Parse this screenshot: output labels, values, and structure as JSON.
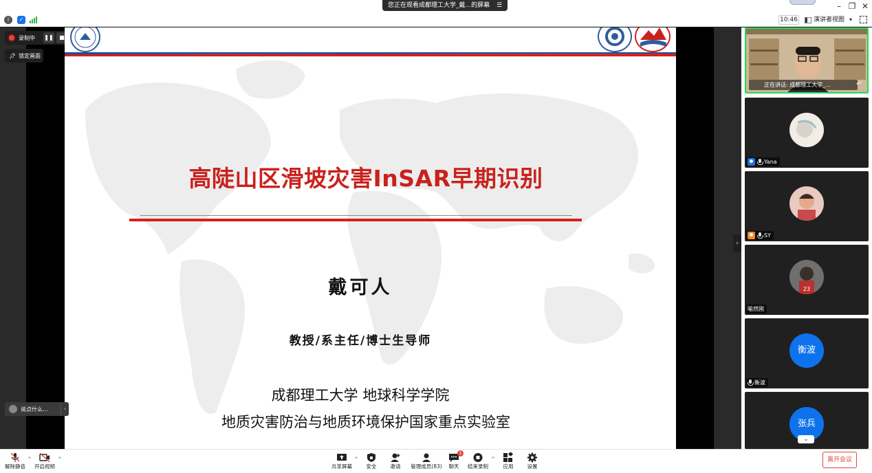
{
  "window": {
    "share_banner": "您正在观看成都理工大学_戴...的屏幕",
    "share_menu_icon": "list-icon",
    "time": "10:46",
    "view_label": "演讲者视图",
    "view_caret": "▾"
  },
  "recording": {
    "label": "录制中",
    "pause": "❚❚",
    "stop": "■",
    "pin_label": "锁定画面"
  },
  "reaction": {
    "label": "说点什么...",
    "chevron": "‹"
  },
  "slide": {
    "title": "高陡山区滑坡灾害InSAR早期识别",
    "name": "戴可人",
    "role": "教授/系主任/博士生导师",
    "org1": "成都理工大学 地球科学学院",
    "org2": "地质灾害防治与地质环境保护国家重点实验室",
    "accent": "#d3201a"
  },
  "gallery": {
    "speaker_label": "正在讲话: 成都理工大学_...",
    "tiles": [
      {
        "name": "Yana"
      },
      {
        "name": "SY"
      },
      {
        "name": "喻然刚"
      },
      {
        "name": "衡波",
        "avatar_text": "衡波"
      },
      {
        "name": "张兵",
        "avatar_text": "张兵"
      }
    ],
    "collapse": "›",
    "more": "⌄"
  },
  "toolbar": {
    "mute": "解除静音",
    "video": "开启视频",
    "share": "共享屏幕",
    "security": "安全",
    "invite": "邀请",
    "participants": "管理成员(83)",
    "chat": "聊天",
    "chat_badge": "1",
    "record": "结束录制",
    "apps": "应用",
    "settings": "设置",
    "leave": "离开会议",
    "caret": "^"
  }
}
